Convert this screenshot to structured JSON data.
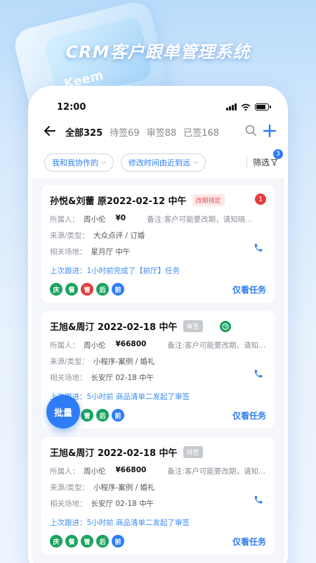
{
  "hero": {
    "title": "CRM客户跟单管理系统",
    "deco_text": "Keem"
  },
  "status_bar": {
    "time": "12:00"
  },
  "nav": {
    "tabs": [
      {
        "label": "全部325",
        "active": true
      },
      {
        "label": "待签69",
        "active": false
      },
      {
        "label": "审签88",
        "active": false
      },
      {
        "label": "已签168",
        "active": false
      }
    ]
  },
  "filters": {
    "scope": "我和我协作的",
    "sort": "修改时间由近到远",
    "filter_label": "筛选",
    "filter_count": "3"
  },
  "cards": [
    {
      "title": "孙悦&刘蕾  原2022-02-12  中午",
      "tag": "改期待定",
      "flag": "1",
      "owner_label": "所属人：",
      "owner": "周小伦",
      "amount": "¥0",
      "note": "备注:客户可能要改期，请知晓...",
      "source_label": "来源/类型：",
      "source": "大众点评 / 订婚",
      "venue_label": "相关场地：",
      "venue": "星月厅  中午",
      "followup": "上次跟进：1小时前完成了【前厅】任务",
      "badges": [
        "庆",
        "餐",
        "管",
        "后",
        "前"
      ],
      "view": "仅看任务"
    },
    {
      "title": "王旭&周汀   2022-02-18  中午",
      "tag": "审签",
      "flag": "clock",
      "owner_label": "所属人：",
      "owner": "周小伦",
      "amount": "¥66800",
      "note": "备注:客户可能要改期，请知晓...",
      "source_label": "来源/类型：",
      "source": "小程序-案例 / 婚礼",
      "venue_label": "相关场地：",
      "venue": "长安厅 02-18 中午",
      "followup": "上次跟进：5小时前 商品清单二发起了审签",
      "badges": [
        "庆",
        "餐",
        "管",
        "后",
        "前"
      ],
      "view": "仅看任务"
    },
    {
      "title": "王旭&周汀   2022-02-18  中午",
      "tag": "待签",
      "flag": "",
      "owner_label": "所属人：",
      "owner": "周小伦",
      "amount": "¥66800",
      "note": "备注:客户可能要改期，请知晓...",
      "source_label": "来源/类型：",
      "source": "小程序-案例 / 婚礼",
      "venue_label": "相关场地：",
      "venue": "长安厅 02-18 中午",
      "followup": "上次跟进：5小时前 商品清单二发起了审签",
      "badges": [
        "庆",
        "餐",
        "管",
        "后",
        "前"
      ],
      "view": "仅看任务"
    }
  ],
  "batch_button": "批量",
  "colors": {
    "accent": "#2f7df6",
    "tag_red": "#e55353",
    "badge_green": "#1aa35f",
    "badge_red": "#e04040"
  }
}
